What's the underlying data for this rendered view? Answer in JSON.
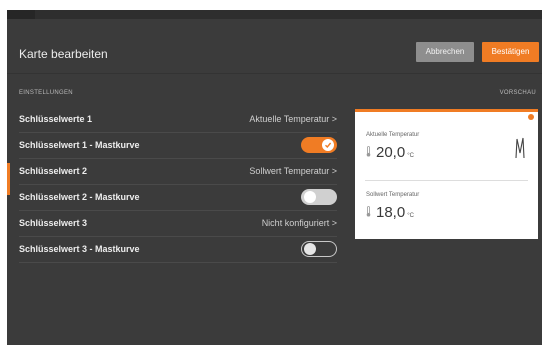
{
  "header": {
    "title": "Karte bearbeiten",
    "cancel_label": "Abbrechen",
    "confirm_label": "Bestätigen"
  },
  "sections": {
    "settings": "EINSTELLUNGEN",
    "preview": "VORSCHAU"
  },
  "settings": [
    {
      "label": "Schlüsselwerte 1",
      "value": "Aktuelle Temperatur"
    },
    {
      "label": "Schlüsselwert 1 - Mastkurve",
      "toggle": "on"
    },
    {
      "label": "Schlüsselwert 2",
      "value": "Sollwert Temperatur"
    },
    {
      "label": "Schlüsselwert 2 - Mastkurve",
      "toggle": "off"
    },
    {
      "label": "Schlüsselwert 3",
      "value": "Nicht konfiguriert"
    },
    {
      "label": "Schlüsselwert 3 - Mastkurve",
      "toggle": "off"
    }
  ],
  "preview": {
    "item1": {
      "label": "Aktuelle Temperatur",
      "value": "20,0",
      "unit": "°C"
    },
    "item2": {
      "label": "Sollwert Temperatur",
      "value": "18,0",
      "unit": "°C"
    }
  },
  "colors": {
    "accent": "#f07c24",
    "background": "#3b3b3b"
  }
}
